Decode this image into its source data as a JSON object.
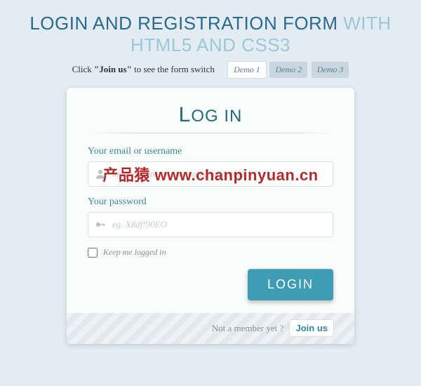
{
  "header": {
    "title_part1": "LOGIN AND REGISTRATION FORM",
    "title_part2": "WITH HTML5 AND CSS3",
    "instruction_prefix": "Click ",
    "instruction_strong": "\"Join us\"",
    "instruction_suffix": " to see the form switch",
    "demos": [
      "Demo 1",
      "Demo 2",
      "Demo 3"
    ],
    "active_demo_index": 0
  },
  "form": {
    "title_first": "L",
    "title_rest": "OG IN",
    "email_label": "Your email or username",
    "email_placeholder": "myusername or myemail@mail.com",
    "password_label": "Your password",
    "password_placeholder": "eg. X8df!90EO",
    "keep_label": "Keep me logged in",
    "submit_label": "LOGIN"
  },
  "footer": {
    "question": "Not a member yet ?",
    "join_label": "Join us"
  },
  "watermark": "产品猿 www.chanpinyuan.cn",
  "icons": {
    "user": "user-icon",
    "key": "key-icon"
  }
}
